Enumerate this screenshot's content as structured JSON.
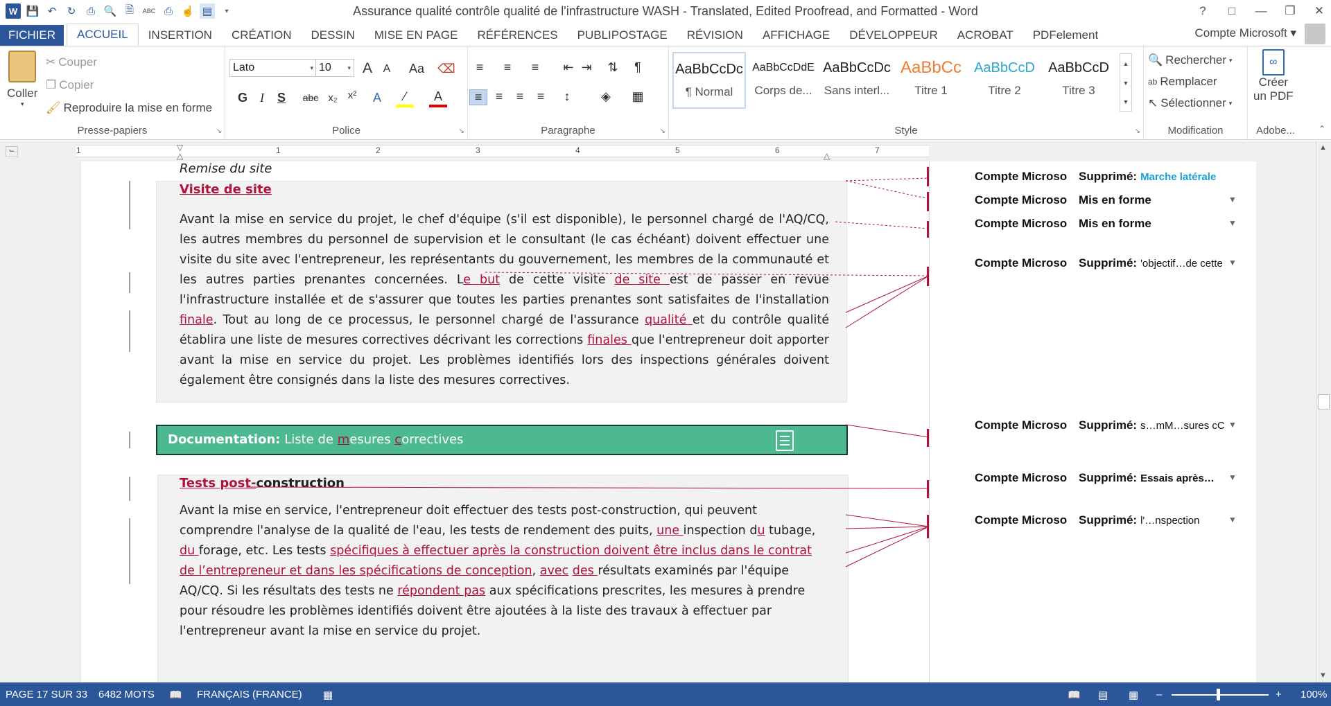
{
  "window": {
    "title": "Assurance qualité  contrôle qualité de l'infrastructure WASH - Translated, Edited Proofread, and Formatted - Word",
    "help": "?",
    "controls": [
      "restore-ribbon",
      "minimize",
      "maximize",
      "close"
    ]
  },
  "quick_access": [
    "word-icon",
    "save-icon",
    "undo-icon",
    "redo-icon",
    "print-icon",
    "print-preview-icon",
    "new-doc-icon",
    "spellcheck-icon",
    "quick-print-icon",
    "touch-mode-icon",
    "page-layout-icon",
    "customize-icon"
  ],
  "tabs": [
    "FICHIER",
    "ACCUEIL",
    "INSERTION",
    "CRÉATION",
    "DESSIN",
    "MISE EN PAGE",
    "RÉFÉRENCES",
    "PUBLIPOSTAGE",
    "RÉVISION",
    "AFFICHAGE",
    "DÉVELOPPEUR",
    "ACROBAT",
    "PDFelement"
  ],
  "active_tab": "ACCUEIL",
  "account": "Compte Microsoft",
  "ribbon": {
    "clipboard": {
      "label": "Presse-papiers",
      "paste": "Coller",
      "cut": "Couper",
      "copy": "Copier",
      "format_painter": "Reproduire la mise en forme"
    },
    "font": {
      "label": "Police",
      "font_name": "Lato",
      "font_size": "10",
      "grow": "A",
      "shrink": "A",
      "case": "Aa",
      "bold": "G",
      "italic": "I",
      "underline": "S",
      "strike": "abc",
      "subscript": "x₂",
      "superscript": "x²"
    },
    "paragraph": {
      "label": "Paragraphe",
      "pilcrow": "¶"
    },
    "styles": {
      "label": "Style",
      "items": [
        {
          "sample": "AaBbCcDc",
          "name": "¶ Normal",
          "color": "#222222"
        },
        {
          "sample": "AaBbCcDdE",
          "name": "Corps de...",
          "color": "#222222"
        },
        {
          "sample": "AaBbCcDc",
          "name": "Sans interl...",
          "color": "#222222"
        },
        {
          "sample": "AaBbCc",
          "name": "Titre 1",
          "color": "#ed7d31"
        },
        {
          "sample": "AaBbCcD",
          "name": "Titre 2",
          "color": "#2aa7c9"
        },
        {
          "sample": "AaBbCcD",
          "name": "Titre 3",
          "color": "#222222"
        }
      ]
    },
    "editing": {
      "label": "Modification",
      "find": "Rechercher",
      "replace": "Remplacer",
      "select": "Sélectionner"
    },
    "adobe": {
      "label": "Adobe...",
      "create_line1": "Créer",
      "create_line2": "un PDF"
    }
  },
  "ruler": {
    "numbers": [
      "1",
      "1",
      "2",
      "3",
      "4",
      "5",
      "6",
      "7"
    ]
  },
  "document": {
    "remise": "Remise du site",
    "visite_heading": "Visite de site",
    "visite_p1": "Avant la mise en service du projet, le chef d'équipe (s'il est disponible), le personnel chargé de l'AQ/CQ, les autres membres du personnel de supervision et le consultant (le cas échéant) doivent effectuer une visite du site avec l'entrepreneur, les représentants du gouvernement, les membres de la communauté et les autres parties prenantes concernées. L",
    "ins_e_but": "e but",
    "visite_p2": " de cette visite ",
    "ins_de_site": "de site ",
    "visite_p3": "est de passer en revue l'infrastructure installée et de s'assurer que toutes les parties prenantes sont satisfaites de l'installation ",
    "ins_finale": "finale",
    "visite_p4": ". Tout au long de ce processus, le personnel chargé de l'assurance ",
    "ins_qualite": "qualité ",
    "visite_p5": "et du contrôle qualité établira une liste de mesures correctives décrivant les corrections ",
    "ins_finales": "finales ",
    "visite_p6": "que l'entrepreneur doit apporter avant la mise en service du projet. Les problèmes identifiés lors des inspections générales doivent également être consignés dans la liste des mesures correctives.",
    "doc_label": "Documentation:",
    "doc_text_a": " Liste de ",
    "doc_ins_m": "m",
    "doc_text_b": "esures ",
    "doc_ins_c": "c",
    "doc_text_c": "orrectives",
    "tests_ins": "Tests post-",
    "tests_rest": "construction",
    "tests_p1": "Avant la mise en service, l'entrepreneur doit effectuer des tests post-construction, qui peuvent comprendre l'analyse de la qualité de l'eau, les tests de rendement des puits, ",
    "ins_une": "une ",
    "tests_p2": "inspection d",
    "ins_u": "u",
    "tests_p3": " tubage, ",
    "ins_du": "du ",
    "tests_p4": "forage, etc. Les tests ",
    "ins_specifiques": "spécifiques à effectuer après la construction doivent être inclus dans le contrat de l’entrepreneur et dans les spécifications de conception",
    "tests_p5": ", ",
    "ins_avec": "avec",
    "tests_p6": " ",
    "ins_des": "des ",
    "tests_p7": "résultats examinés par l'équipe AQ/CQ. Si les résultats des tests ne ",
    "ins_repondent": "répondent pas",
    "tests_p8": " aux spécifications prescrites, les mesures à prendre pour résoudre les problèmes identifiés doivent être ajoutées à la liste des travaux à effectuer par l'entrepreneur avant la mise en service du projet."
  },
  "balloons": [
    {
      "author": "Compte Microso",
      "action": "Supprimé:",
      "text": "Marche latérale",
      "color": "#1aa0d8"
    },
    {
      "author": "Compte Microso",
      "action": "Mis en forme",
      "text": ""
    },
    {
      "author": "Compte Microso",
      "action": "Mis en forme",
      "text": ""
    },
    {
      "author": "Compte Microso",
      "action": "Supprimé:",
      "text": "'objectif…de cette"
    },
    {
      "author": "Compte Microso",
      "action": "Supprimé:",
      "text": "s…mM…sures cC"
    },
    {
      "author": "Compte Microso",
      "action": "Supprimé:",
      "text": "Essais après…"
    },
    {
      "author": "Compte Microso",
      "action": "Supprimé:",
      "text": "l'…nspection"
    }
  ],
  "status_bar": {
    "page": "PAGE 17 SUR 33",
    "words": "6482 MOTS",
    "language": "FRANÇAIS (FRANCE)",
    "zoom": "100%",
    "zoom_minus": "–",
    "zoom_plus": "+"
  },
  "colors": {
    "accent": "#2b579a",
    "revision": "#b0123a",
    "doc_bar": "#4db991"
  }
}
